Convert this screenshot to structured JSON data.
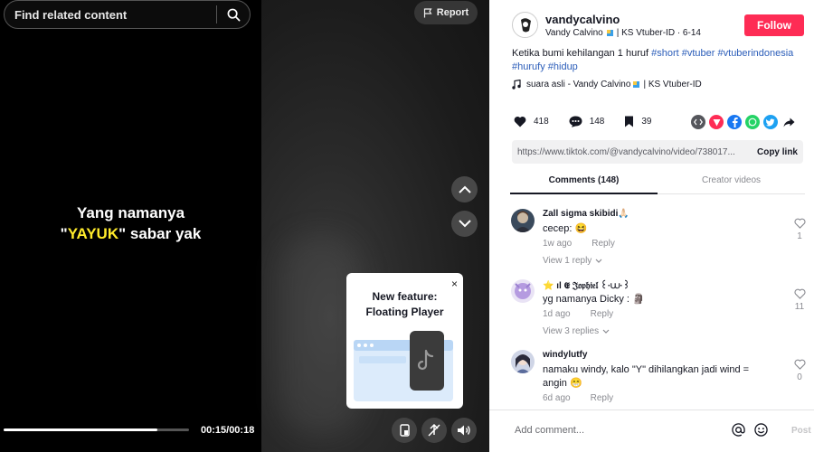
{
  "video": {
    "search_placeholder": "Find related content",
    "caption_line1": "Yang namanya",
    "caption_quote_open": "\"",
    "caption_highlight": "YAYUK",
    "caption_quote_close": "\"",
    "caption_rest": " sabar yak",
    "time": "00:15/00:18",
    "progress": 0.83,
    "report_label": "Report",
    "popup_title_line1": "New feature:",
    "popup_title_line2": "Floating Player",
    "popup_close": "×"
  },
  "author": {
    "handle": "vandycalvino",
    "display_name": "Vandy Calvino",
    "sub_rest": "| KS Vtuber-ID · 6-14",
    "follow_label": "Follow"
  },
  "description": {
    "text": "Ketika bumi kehilangan 1 huruf ",
    "tags": [
      "#short",
      "#vtuber",
      "#vtuberindonesia",
      "#hurufy",
      "#hidup"
    ]
  },
  "music": {
    "prefix": "suara asli - Vandy Calvino",
    "suffix": "| KS Vtuber-ID"
  },
  "stats": {
    "likes": "418",
    "comments": "148",
    "saves": "39"
  },
  "link": {
    "url": "https://www.tiktok.com/@vandycalvino/video/738017...",
    "copy_label": "Copy link"
  },
  "tabs": {
    "comments": "Comments (148)",
    "creator_videos": "Creator videos"
  },
  "comments": [
    {
      "user": "Zall sigma skibidi🙏🏻",
      "text": "cecep: 😆",
      "time": "1w ago",
      "reply": "Reply",
      "replies": "View 1 reply",
      "likes": "1"
    },
    {
      "user": "⭐ ıl 𝕰 𝔍𝔬𝔭𝔥𝔦𝔢𝔩 ꒰·⩊·꒱",
      "text": "yg namanya Dicky : 🗿",
      "time": "1d ago",
      "reply": "Reply",
      "replies": "View 3 replies",
      "likes": "11"
    },
    {
      "user": "windylutfy",
      "text": "namaku windy, kalo \"Y\" dihilangkan jadi wind = angin 😁",
      "time": "6d ago",
      "reply": "Reply",
      "likes": "0"
    }
  ],
  "composer": {
    "placeholder": "Add comment...",
    "post_label": "Post"
  },
  "colors": {
    "accent": "#fe2c55",
    "hashtag": "#2b5db9",
    "caption_highlight": "#ffeb2b"
  }
}
